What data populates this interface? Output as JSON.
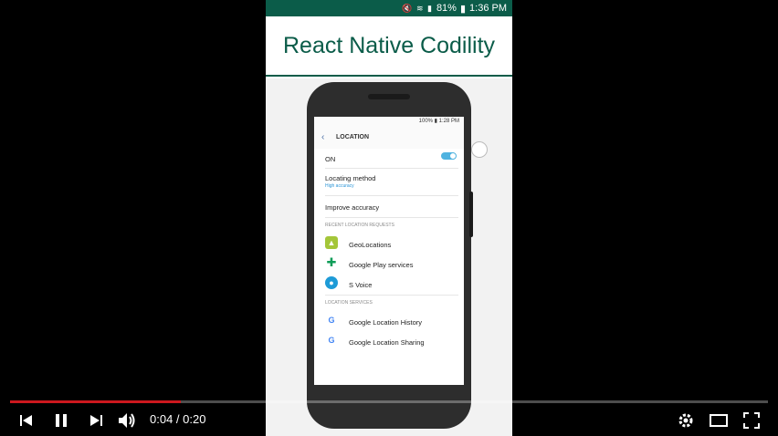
{
  "recording": {
    "status_time": "1:36 PM",
    "status_battery": "81%",
    "title": "React Native Codility"
  },
  "phone": {
    "status_text": "100% ▮ 1:28 PM",
    "header_title": "LOCATION",
    "on_label": "ON",
    "locating_method": {
      "label": "Locating method",
      "value": "High accuracy"
    },
    "improve_accuracy": "Improve accuracy",
    "recent_header": "RECENT LOCATION REQUESTS",
    "recent_apps": [
      {
        "label": "GeoLocations",
        "icon": "android-icon"
      },
      {
        "label": "Google Play services",
        "icon": "puzzle-icon"
      },
      {
        "label": "S Voice",
        "icon": "microphone-icon"
      }
    ],
    "services_header": "LOCATION SERVICES",
    "services": [
      {
        "label": "Google Location History",
        "icon": "google-icon"
      },
      {
        "label": "Google Location Sharing",
        "icon": "google-icon"
      }
    ]
  },
  "player": {
    "current_time": "0:04",
    "duration": "0:20",
    "time_display": "0:04 / 0:20",
    "progress_fraction": 0.2,
    "accent_color": "#cc181e"
  }
}
